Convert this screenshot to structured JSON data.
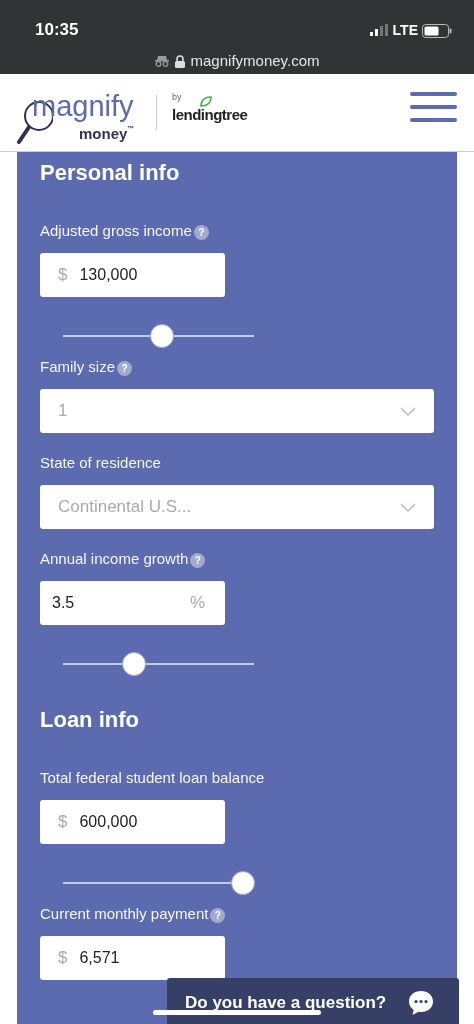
{
  "status_bar": {
    "time": "10:35",
    "network": "LTE"
  },
  "browser": {
    "url": "magnifymoney.com"
  },
  "header": {
    "logo_word": "magnify",
    "logo_sub": "money",
    "logo_tm": "™",
    "by": "by",
    "partner": "lendingtree"
  },
  "sections": [
    {
      "title": "Personal info",
      "items": [
        {
          "kind": "label",
          "text": "Adjusted gross income",
          "help": "?"
        },
        {
          "kind": "money",
          "prefix": "$",
          "value": "130,000"
        },
        {
          "kind": "slider",
          "level": 0.52
        },
        {
          "kind": "label",
          "text": "Family size",
          "help": "?"
        },
        {
          "kind": "select",
          "value": "1"
        },
        {
          "kind": "label",
          "text": "State of residence"
        },
        {
          "kind": "select",
          "value": "Continental U.S..."
        },
        {
          "kind": "label",
          "text": "Annual income growth",
          "help": "?"
        },
        {
          "kind": "percent",
          "value": "3.5",
          "suffix": "%"
        },
        {
          "kind": "slider",
          "level": 0.37
        }
      ]
    },
    {
      "title": "Loan info",
      "items": [
        {
          "kind": "label",
          "text": "Total federal student loan balance"
        },
        {
          "kind": "money",
          "prefix": "$",
          "value": "600,000"
        },
        {
          "kind": "slider",
          "level": 0.94
        },
        {
          "kind": "label",
          "text": "Current monthly payment",
          "help": "?"
        },
        {
          "kind": "money",
          "prefix": "$",
          "value": "6,571"
        }
      ]
    }
  ],
  "chat": {
    "text": "Do you have a question?"
  }
}
